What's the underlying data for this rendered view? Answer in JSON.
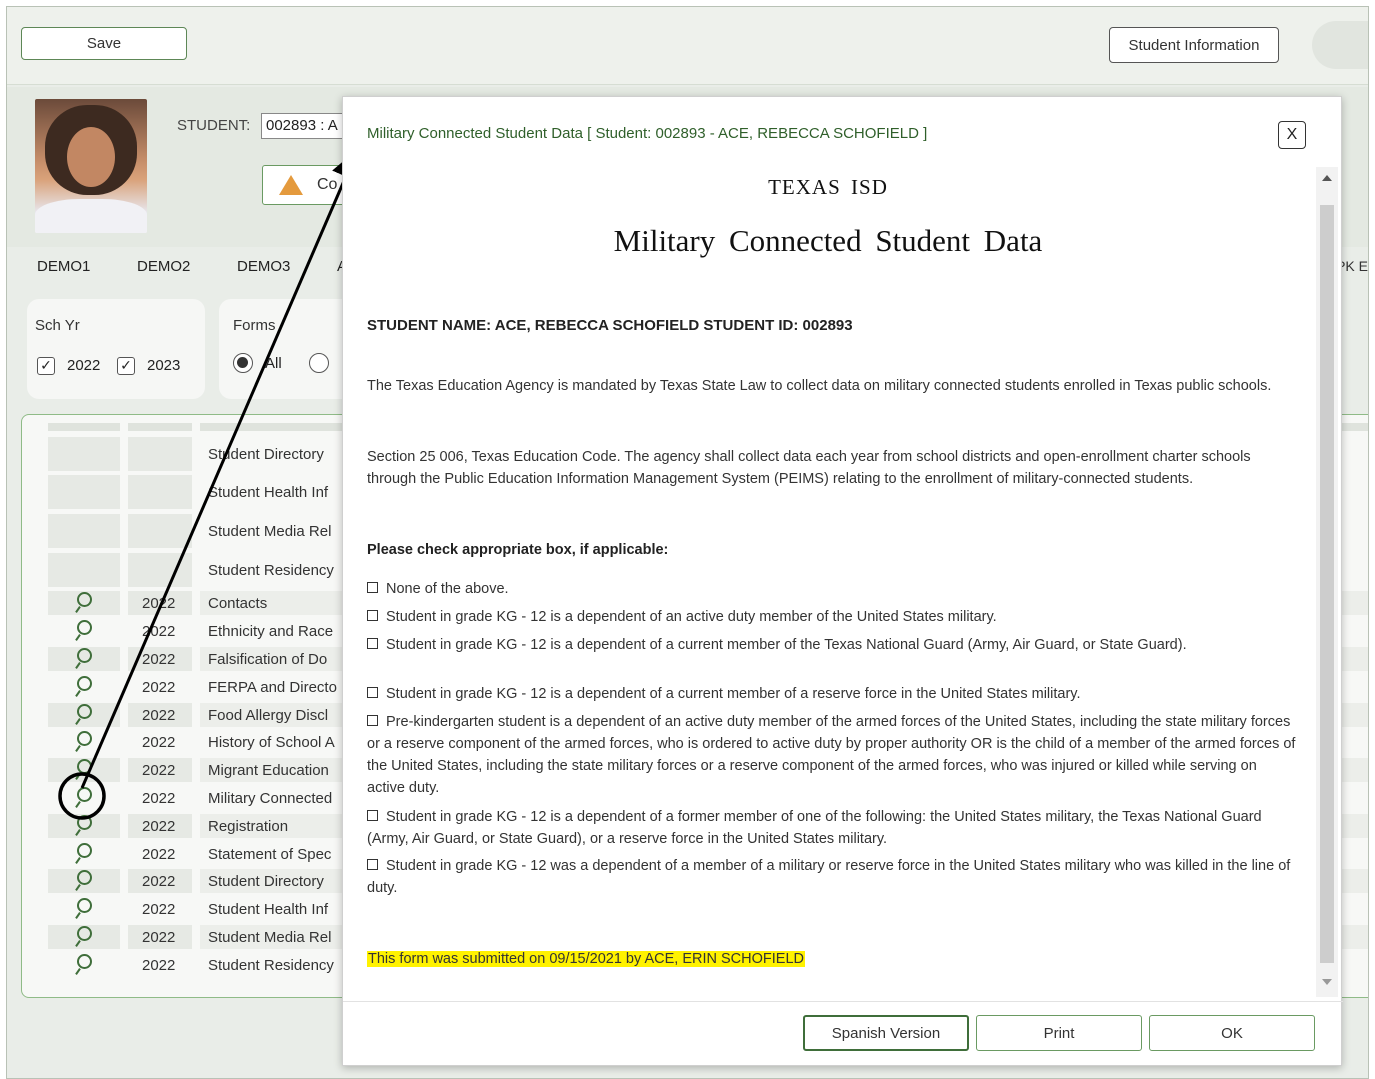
{
  "toolbar": {
    "save_label": "Save",
    "student_info_label": "Student Information"
  },
  "student": {
    "label": "STUDENT:",
    "input_value": "002893 : A",
    "warning_label": "Co"
  },
  "tabs": [
    "DEMO1",
    "DEMO2",
    "DEMO3",
    "A",
    "PK E"
  ],
  "filters": {
    "sch_yr_title": "Sch Yr",
    "years": [
      "2022",
      "2023"
    ],
    "forms_title": "Forms",
    "forms_option_all": "All"
  },
  "grid": {
    "rows": [
      {
        "year": "",
        "form": "Student Directory",
        "icon": false
      },
      {
        "year": "",
        "form": "Student Health Inf",
        "icon": false
      },
      {
        "year": "",
        "form": "Student Media Rel",
        "icon": false
      },
      {
        "year": "",
        "form": "Student Residency",
        "icon": false
      },
      {
        "year": "2022",
        "form": "Contacts",
        "icon": true
      },
      {
        "year": "2022",
        "form": "Ethnicity and Race",
        "icon": true
      },
      {
        "year": "2022",
        "form": "Falsification of Do",
        "icon": true
      },
      {
        "year": "2022",
        "form": "FERPA and Directo",
        "icon": true
      },
      {
        "year": "2022",
        "form": "Food Allergy Discl",
        "icon": true
      },
      {
        "year": "2022",
        "form": "History of School A",
        "icon": true
      },
      {
        "year": "2022",
        "form": "Migrant Education",
        "icon": true
      },
      {
        "year": "2022",
        "form": "Military Connected",
        "icon": true
      },
      {
        "year": "2022",
        "form": "Registration",
        "icon": true
      },
      {
        "year": "2022",
        "form": "Statement of Spec",
        "icon": true
      },
      {
        "year": "2022",
        "form": "Student Directory",
        "icon": true
      },
      {
        "year": "2022",
        "form": "Student Health Inf",
        "icon": true
      },
      {
        "year": "2022",
        "form": "Student Media Rel",
        "icon": true
      },
      {
        "year": "2022",
        "form": "Student Residency",
        "icon": true
      }
    ]
  },
  "modal": {
    "title": "Military Connected Student Data [ Student: 002893 - ACE, REBECCA SCHOFIELD ]",
    "close_label": "X",
    "district": "TEXAS ISD",
    "form_title": "Military Connected Student Data",
    "student_line": "STUDENT NAME: ACE, REBECCA SCHOFIELD STUDENT ID: 002893",
    "intro": "The Texas Education Agency is mandated by Texas State Law to collect data on military connected students enrolled in Texas public schools.",
    "section": "Section 25 006, Texas Education Code. The agency shall collect data each year from school districts and open-enrollment charter schools through the Public Education Information Management System (PEIMS) relating to the enrollment of military-connected students.",
    "instruction": "Please check appropriate box, if applicable:",
    "options": [
      "None of the above.",
      "Student in grade KG - 12 is a dependent of an active duty member of the United States military.",
      "Student in grade KG - 12 is a dependent of a current member of the Texas National Guard (Army, Air Guard, or State Guard).",
      "Student in grade KG - 12 is a dependent of a current member of a reserve force in the United States military.",
      "Pre-kindergarten student is a dependent of an active duty member of the armed forces of the United States, including the state military forces or a reserve component of the armed forces, who is ordered to active duty by proper authority OR is the child of a member of the armed forces of the United States, including the state military forces or a reserve component of the armed forces, who was injured or killed while serving on active duty.",
      "Student in grade KG - 12 is a dependent of a former member of one of the following: the United States military, the Texas National Guard (Army, Air Guard, or State Guard), or a reserve force in the United States military.",
      "Student in grade KG - 12 was a dependent of a member of a military or reserve force in the United States military who was killed in the line of duty."
    ],
    "submitted": "This form was submitted on 09/15/2021 by ACE, ERIN SCHOFIELD",
    "spanish_label": "Spanish Version",
    "print_label": "Print",
    "ok_label": "OK"
  },
  "colors": {
    "accent": "#3f6e3a",
    "highlight": "#fff200"
  }
}
